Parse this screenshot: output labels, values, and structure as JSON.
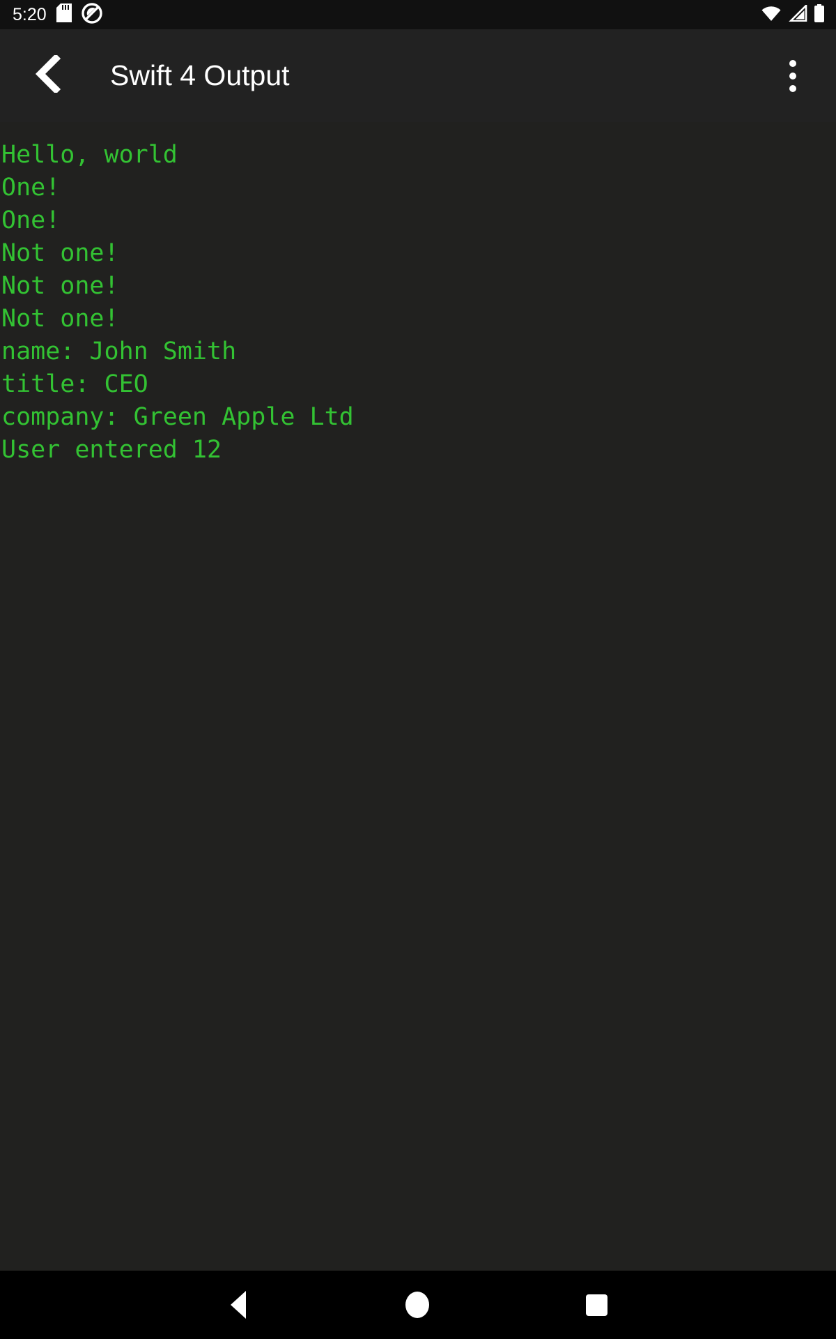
{
  "status_bar": {
    "clock": "5:20",
    "left_icons": [
      {
        "name": "sd-card-icon",
        "label": "SD card"
      },
      {
        "name": "do-not-disturb-icon",
        "label": "Do not disturb"
      }
    ],
    "right_icons": [
      {
        "name": "wifi-icon",
        "label": "Wi-Fi"
      },
      {
        "name": "cellular-signal-icon",
        "label": "Cellular signal"
      },
      {
        "name": "battery-icon",
        "label": "Battery full"
      }
    ],
    "background_color": "#111111",
    "foreground_color": "#ffffff"
  },
  "app_bar": {
    "title": "Swift 4 Output",
    "back_icon": "chevron-left-icon",
    "overflow_icon": "overflow-menu-icon",
    "background_color": "#222222",
    "title_color": "#ffffff"
  },
  "console": {
    "background_color": "#21211f",
    "text_color": "#33c233",
    "lines": [
      "Hello, world",
      "One!",
      "One!",
      "Not one!",
      "Not one!",
      "Not one!",
      "name: John Smith",
      "title: CEO",
      "company: Green Apple Ltd",
      "User entered 12"
    ]
  },
  "navigation_bar": {
    "background_color": "#000000",
    "buttons": [
      {
        "name": "nav-back-button",
        "label": "Back"
      },
      {
        "name": "nav-home-button",
        "label": "Home"
      },
      {
        "name": "nav-recents-button",
        "label": "Recents"
      }
    ]
  }
}
